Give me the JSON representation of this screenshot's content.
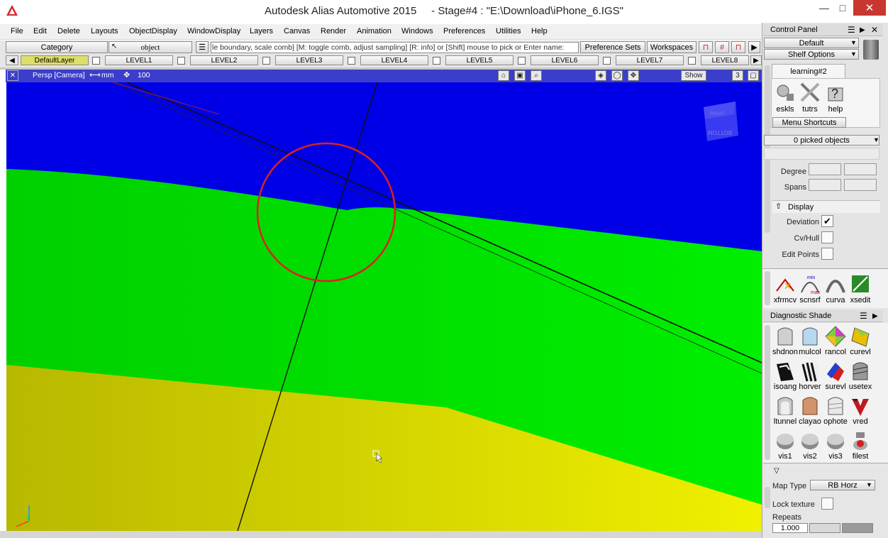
{
  "window": {
    "app_title": "Autodesk Alias Automotive 2015",
    "doc_title": "- Stage#4 : \"E:\\Download\\iPhone_6.IGS\"",
    "minimize": "—",
    "maximize": "□",
    "close": "✕"
  },
  "menu": [
    "File",
    "Edit",
    "Delete",
    "Layouts",
    "ObjectDisplay",
    "WindowDisplay",
    "Layers",
    "Canvas",
    "Render",
    "Animation",
    "Windows",
    "Preferences",
    "Utilities",
    "Help"
  ],
  "toolbar": {
    "category_label": "Category",
    "object_label": "object",
    "prompt_text": "le boundary, scale comb] [M: toggle comb, adjust sampling] [R: info] or [Shift] mouse to pick or Enter name:",
    "preference_sets": "Preference Sets",
    "workspaces": "Workspaces"
  },
  "layers": {
    "default": "DefaultLayer",
    "items": [
      "LEVEL1",
      "LEVEL2",
      "LEVEL3",
      "LEVEL4",
      "LEVEL5",
      "LEVEL6",
      "LEVEL7",
      "LEVEL8"
    ]
  },
  "viewport": {
    "camera_label": "Persp [Camera]",
    "units": "mm",
    "scale": "100",
    "show_button": "Show",
    "view_number": "3",
    "viewcube_labels": [
      "RIGHT",
      "BOTTOM"
    ],
    "colors": {
      "blue": "#0000e6",
      "green": "#00e600",
      "yellow": "#e6e600",
      "header": "#3b3ecb",
      "circle": "#dd2020"
    }
  },
  "control_panel": {
    "title": "Control Panel",
    "default_label": "Default",
    "shelf_options": "Shelf Options",
    "shelf_tab": "learning#2",
    "shelf_items": [
      "eskls",
      "tutrs",
      "help"
    ],
    "menu_shortcuts": "Menu Shortcuts",
    "picked_objects": "0 picked objects",
    "degree_label": "Degree",
    "spans_label": "Spans",
    "display_section": "Display",
    "deviation_label": "Deviation",
    "cvhull_label": "Cv/Hull",
    "editpoints_label": "Edit Points",
    "shelf2_items": [
      "xfrmcv",
      "scnsrf",
      "curva",
      "xsedit"
    ]
  },
  "diagnostic_shade": {
    "title": "Diagnostic Shade",
    "rows": [
      [
        "shdnon",
        "mulcol",
        "rancol",
        "curevl"
      ],
      [
        "isoang",
        "horver",
        "surevl",
        "usetex"
      ],
      [
        "ltunnel",
        "clayao",
        "ophote",
        "vred"
      ],
      [
        "vis1",
        "vis2",
        "vis3",
        "filest"
      ]
    ],
    "map_type_label": "Map Type",
    "map_type_value": "RB Horz",
    "lock_texture_label": "Lock texture",
    "repeats_label": "Repeats",
    "repeats_value": "1.000"
  }
}
